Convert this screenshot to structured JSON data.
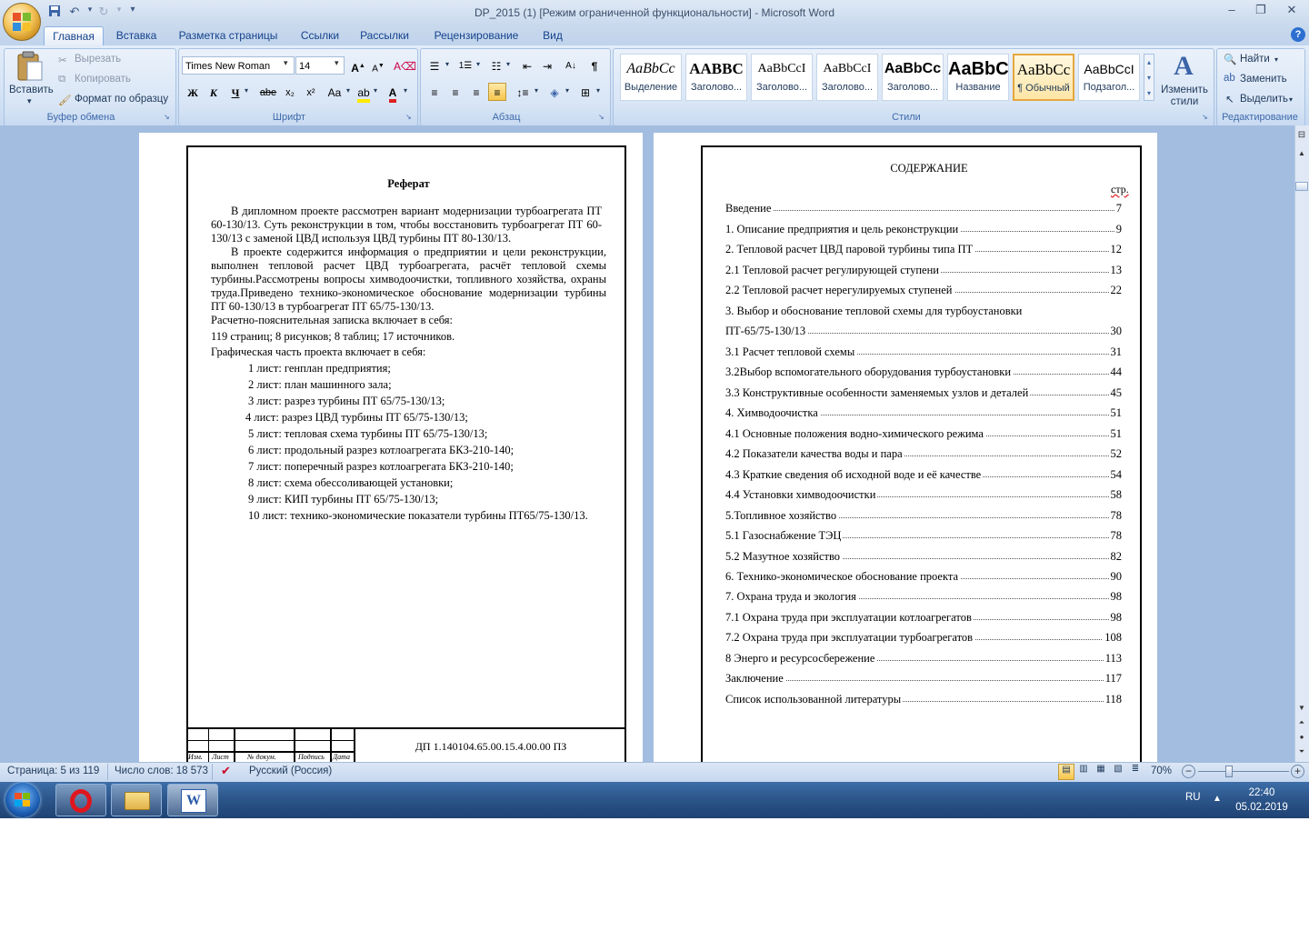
{
  "window": {
    "title": "DP_2015 (1) [Режим ограниченной функциональности] - Microsoft Word"
  },
  "tabs": [
    "Главная",
    "Вставка",
    "Разметка страницы",
    "Ссылки",
    "Рассылки",
    "Рецензирование",
    "Вид"
  ],
  "ribbon": {
    "clipboard": {
      "paste": "Вставить",
      "cut": "Вырезать",
      "copy": "Копировать",
      "format_painter": "Формат по образцу",
      "label": "Буфер обмена"
    },
    "font": {
      "name": "Times New Roman",
      "size": "14",
      "label": "Шрифт",
      "bold": "Ж",
      "italic": "К",
      "underline": "Ч",
      "strike": "abe",
      "subscript": "x₂",
      "superscript": "x²",
      "change_case": "Aa"
    },
    "paragraph": {
      "label": "Абзац"
    },
    "styles": {
      "label": "Стили",
      "items": [
        {
          "sample": "AaBbCc",
          "name": "Выделение"
        },
        {
          "sample": "AABBC",
          "name": "Заголово..."
        },
        {
          "sample": "AaBbCcI",
          "name": "Заголово..."
        },
        {
          "sample": "AaBbCcI",
          "name": "Заголово..."
        },
        {
          "sample": "AaBbCc",
          "name": "Заголово..."
        },
        {
          "sample": "AaBbC",
          "name": "Название"
        },
        {
          "sample": "AaBbCc",
          "name": "¶ Обычный"
        },
        {
          "sample": "AaBbCcI",
          "name": "Подзагол..."
        }
      ],
      "change_styles": "Изменить стили"
    },
    "editing": {
      "find": "Найти",
      "replace": "Заменить",
      "select": "Выделить",
      "label": "Редактирование"
    }
  },
  "left_page": {
    "heading": "Реферат",
    "para1": "В дипломном проекте рассмотрен вариант модернизации турбоагрегата ПТ 60-130/13. Суть реконструкции в том, чтобы восстановить турбоагрегат ПТ 60-130/13 с заменой ЦВД используя ЦВД турбины ПТ 80-130/13.",
    "para2": "В проекте содержится информация о предприятии и цели реконструкции, выполнен тепловой расчет ЦВД турбоагрегата, расчёт тепловой схемы турбины.Рассмотрены вопросы химводоочистки, топливного хозяйства, охраны труда.Приведено технико-экономическое обоснование модернизации турбины ПТ 60-130/13 в турбоагрегат ПТ 65/75-130/13.",
    "line1": "Расчетно-пояснительная записка включает в себя:",
    "line2": "119 страниц; 8 рисунков; 8 таблиц; 17 источников.",
    "line3": "Графическая часть проекта включает в себя:",
    "sheets": [
      "1 лист: генплан предприятия;",
      "2 лист: план машинного зала;",
      "3 лист: разрез турбины ПТ 65/75-130/13;",
      "4 лист: разрез ЦВД турбины ПТ 65/75-130/13;",
      "5 лист: тепловая схема турбины ПТ 65/75-130/13;",
      "6 лист: продольный разрез котлоагрегата БКЗ-210-140;",
      "7 лист: поперечный разрез котлоагрегата БКЗ-210-140;",
      "8 лист: схема обессоливающей установки;",
      "9 лист: КИП турбины ПТ 65/75-130/13;",
      "10 лист: технико-экономические показатели турбины ПТ65/75-130/13."
    ],
    "stamp": {
      "code": "ДП 1.140104.65.00.15.4.00.00 ПЗ",
      "cols": [
        "Изм.",
        "Лист",
        "№ докум.",
        "Подпись",
        "Дата"
      ]
    }
  },
  "right_page": {
    "heading": "СОДЕРЖАНИЕ",
    "page_label": "стр.",
    "toc": [
      {
        "title": "Введение",
        "page": "7"
      },
      {
        "title": "1. Описание предприятия и цель реконструкции",
        "page": "9"
      },
      {
        "title": "2. Тепловой расчет ЦВД паровой турбины типа ПТ",
        "page": "12"
      },
      {
        "title": "2.1 Тепловой расчет регулирующей ступени",
        "page": "13"
      },
      {
        "title": "2.2 Тепловой расчет нерегулируемых ступеней",
        "page": "22"
      },
      {
        "title": "3. Выбор и обоснование тепловой схемы для турбоустановки",
        "page": ""
      },
      {
        "title": "ПТ-65/75-130/13",
        "page": "30"
      },
      {
        "title": "3.1 Расчет тепловой схемы",
        "page": "31"
      },
      {
        "title": "3.2Выбор вспомогательного оборудования турбоустановки",
        "page": "44"
      },
      {
        "title": "3.3 Конструктивные особенности заменяемых узлов и деталей",
        "page": "45"
      },
      {
        "title": "4. Химводоочистка",
        "page": "51"
      },
      {
        "title": "4.1 Основные положения водно-химического режима",
        "page": "51"
      },
      {
        "title": "4.2 Показатели качества воды и пара",
        "page": "52"
      },
      {
        "title": "4.3 Краткие сведения об исходной воде и её качестве",
        "page": "54"
      },
      {
        "title": "4.4 Установки химводоочистки",
        "page": "58"
      },
      {
        "title": "5.Топливное хозяйство",
        "page": "78"
      },
      {
        "title": "5.1 Газоснабжение ТЭЦ",
        "page": "78"
      },
      {
        "title": "5.2 Мазутное хозяйство",
        "page": "82"
      },
      {
        "title": "6. Технико-экономическое обоснование проекта",
        "page": "90"
      },
      {
        "title": "7. Охрана труда и экология",
        "page": "98"
      },
      {
        "title": "7.1 Охрана труда при эксплуатации котлоагрегатов",
        "page": "98"
      },
      {
        "title": "7.2 Охрана труда при эксплуатации турбоагрегатов",
        "page": "108"
      },
      {
        "title": "8 Энерго и ресурсосбережение",
        "page": "113"
      },
      {
        "title": "Заключение",
        "page": "117"
      },
      {
        "title": "Список использованной литературы",
        "page": "118"
      }
    ]
  },
  "statusbar": {
    "page": "Страница: 5 из 119",
    "words": "Число слов: 18 573",
    "language": "Русский (Россия)",
    "zoom": "70%"
  },
  "taskbar": {
    "lang": "RU",
    "time": "22:40",
    "date": "05.02.2019"
  },
  "colors": {
    "ribbon": "#d4e3f5",
    "doc_background": "#a3bde0",
    "taskbar": "#2b5489"
  }
}
